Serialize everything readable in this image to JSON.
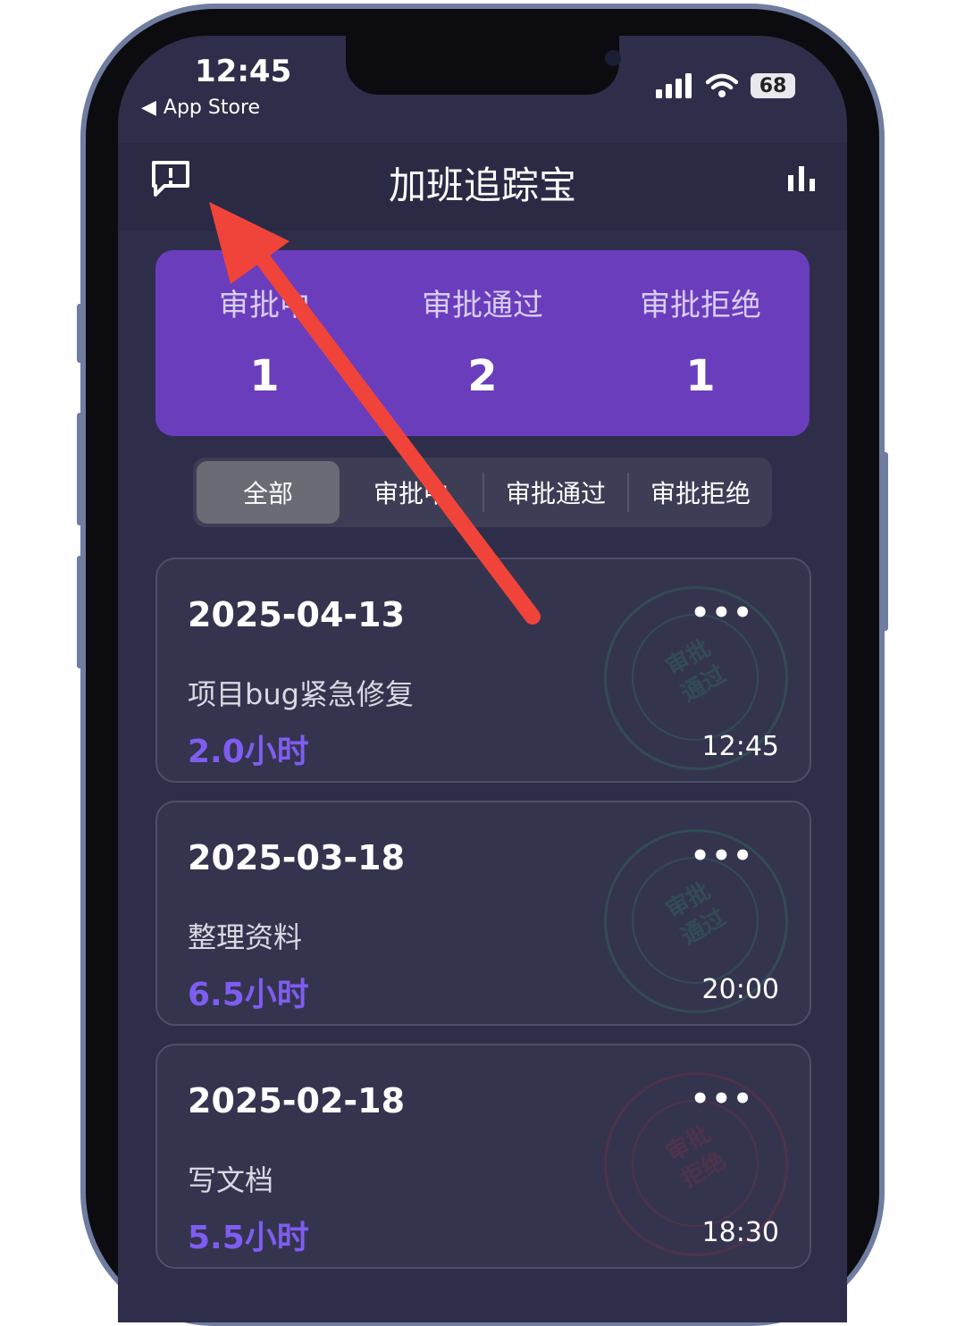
{
  "status_bar": {
    "time": "12:45",
    "back_label": "App Store",
    "battery": "68"
  },
  "navbar": {
    "title": "加班追踪宝",
    "left_icon": "feedback-icon",
    "right_icon": "bar-chart-icon"
  },
  "summary": [
    {
      "label": "审批中",
      "value": "1"
    },
    {
      "label": "审批通过",
      "value": "2"
    },
    {
      "label": "审批拒绝",
      "value": "1"
    }
  ],
  "tabs": [
    "全部",
    "审批中",
    "审批通过",
    "审批拒绝"
  ],
  "active_tab": "全部",
  "records": [
    {
      "date": "2025-04-13",
      "description": "项目bug紧急修复",
      "hours": "2.0小时",
      "time": "12:45",
      "stamp": "审批通过",
      "stamp_line1": "审批",
      "stamp_line2": "通过"
    },
    {
      "date": "2025-03-18",
      "description": "整理资料",
      "hours": "6.5小时",
      "time": "20:00",
      "stamp": "审批通过",
      "stamp_line1": "审批",
      "stamp_line2": "通过"
    },
    {
      "date": "2025-02-18",
      "description": "写文档",
      "hours": "5.5小时",
      "time": "18:30",
      "stamp": "审批拒绝",
      "stamp_line1": "审批",
      "stamp_line2": "拒绝"
    }
  ],
  "more_icon": "more-dots-icon",
  "colors": {
    "accent": "#6a3dbd",
    "hours": "#7e5df0",
    "annotation_arrow": "#f0443a"
  }
}
